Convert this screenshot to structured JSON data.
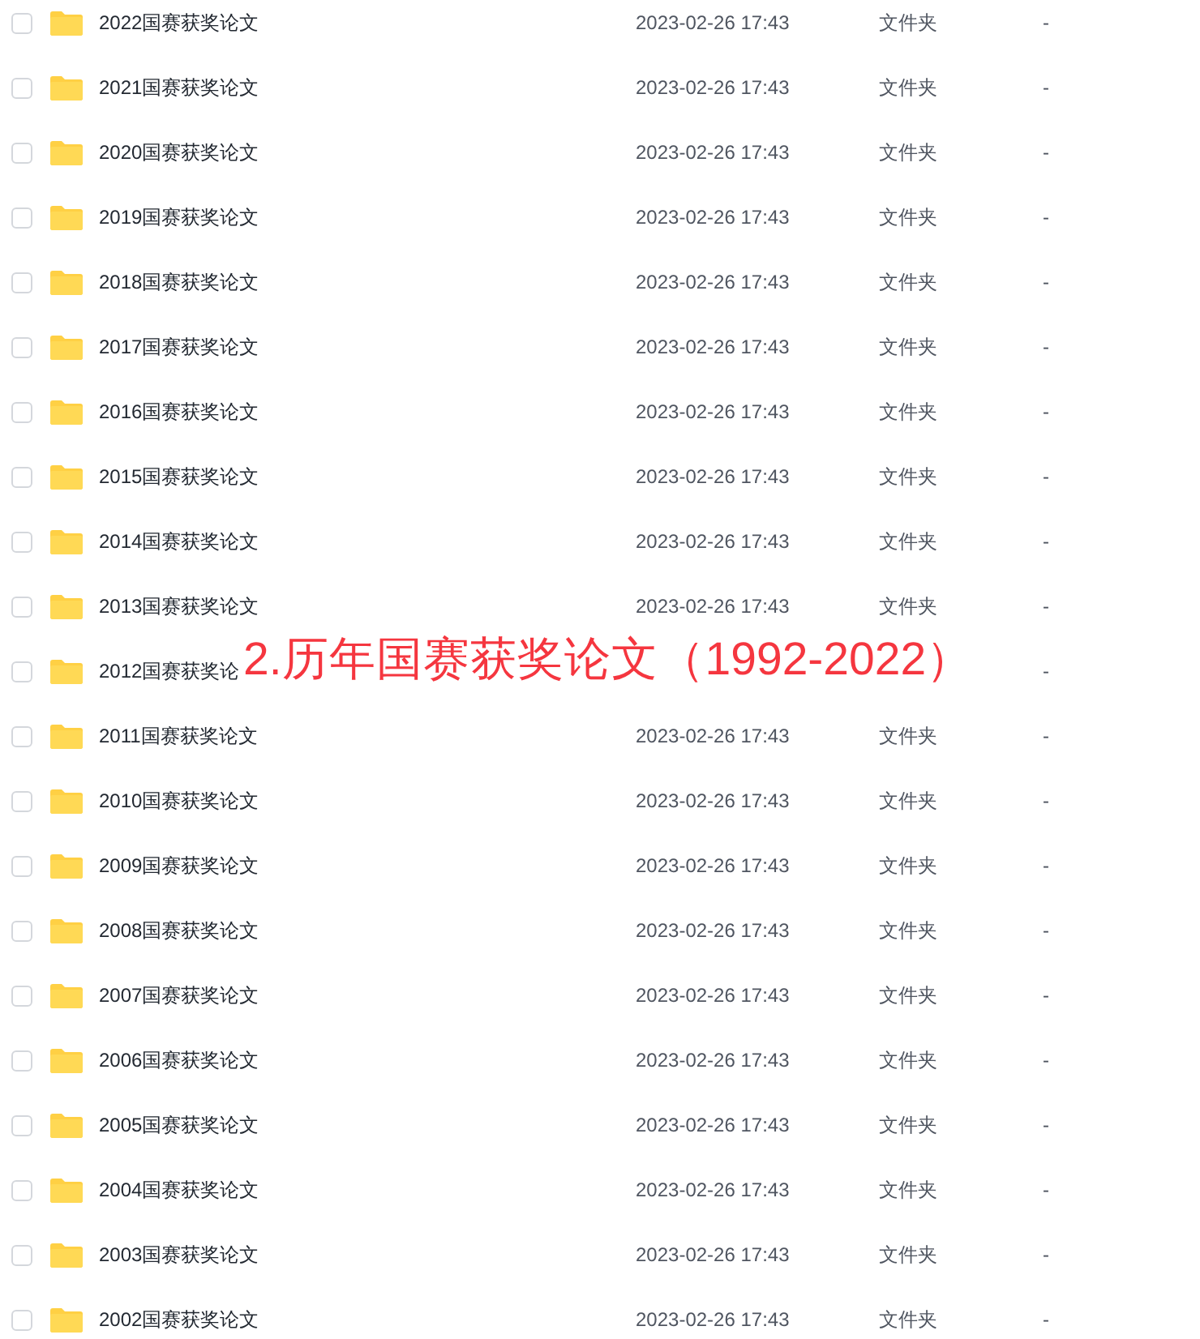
{
  "rows": [
    {
      "name": "2022国赛获奖论文",
      "modified": "2023-02-26 17:43",
      "type": "文件夹",
      "size": "-",
      "checked": false
    },
    {
      "name": "2021国赛获奖论文",
      "modified": "2023-02-26 17:43",
      "type": "文件夹",
      "size": "-",
      "checked": false
    },
    {
      "name": "2020国赛获奖论文",
      "modified": "2023-02-26 17:43",
      "type": "文件夹",
      "size": "-",
      "checked": false
    },
    {
      "name": "2019国赛获奖论文",
      "modified": "2023-02-26 17:43",
      "type": "文件夹",
      "size": "-",
      "checked": false
    },
    {
      "name": "2018国赛获奖论文",
      "modified": "2023-02-26 17:43",
      "type": "文件夹",
      "size": "-",
      "checked": false
    },
    {
      "name": "2017国赛获奖论文",
      "modified": "2023-02-26 17:43",
      "type": "文件夹",
      "size": "-",
      "checked": false
    },
    {
      "name": "2016国赛获奖论文",
      "modified": "2023-02-26 17:43",
      "type": "文件夹",
      "size": "-",
      "checked": false
    },
    {
      "name": "2015国赛获奖论文",
      "modified": "2023-02-26 17:43",
      "type": "文件夹",
      "size": "-",
      "checked": false
    },
    {
      "name": "2014国赛获奖论文",
      "modified": "2023-02-26 17:43",
      "type": "文件夹",
      "size": "-",
      "checked": false
    },
    {
      "name": "2013国赛获奖论文",
      "modified": "2023-02-26 17:43",
      "type": "文件夹",
      "size": "-",
      "checked": false
    },
    {
      "name": "2012国赛获奖论",
      "size": "-",
      "checked": false
    },
    {
      "name": "2011国赛获奖论文",
      "modified": "2023-02-26 17:43",
      "type": "文件夹",
      "size": "-",
      "checked": false
    },
    {
      "name": "2010国赛获奖论文",
      "modified": "2023-02-26 17:43",
      "type": "文件夹",
      "size": "-",
      "checked": false
    },
    {
      "name": "2009国赛获奖论文",
      "modified": "2023-02-26 17:43",
      "type": "文件夹",
      "size": "-",
      "checked": false
    },
    {
      "name": "2008国赛获奖论文",
      "modified": "2023-02-26 17:43",
      "type": "文件夹",
      "size": "-",
      "checked": false
    },
    {
      "name": "2007国赛获奖论文",
      "modified": "2023-02-26 17:43",
      "type": "文件夹",
      "size": "-",
      "checked": false
    },
    {
      "name": "2006国赛获奖论文",
      "modified": "2023-02-26 17:43",
      "type": "文件夹",
      "size": "-",
      "checked": false
    },
    {
      "name": "2005国赛获奖论文",
      "modified": "2023-02-26 17:43",
      "type": "文件夹",
      "size": "-",
      "checked": false
    },
    {
      "name": "2004国赛获奖论文",
      "modified": "2023-02-26 17:43",
      "type": "文件夹",
      "size": "-",
      "checked": false
    },
    {
      "name": "2003国赛获奖论文",
      "modified": "2023-02-26 17:43",
      "type": "文件夹",
      "size": "-",
      "checked": false
    },
    {
      "name": "2002国赛获奖论文",
      "modified": "2023-02-26 17:43",
      "type": "文件夹",
      "size": "-",
      "checked": false
    }
  ],
  "overlay_caption": "2.历年国赛获奖论文（1992-2022）"
}
